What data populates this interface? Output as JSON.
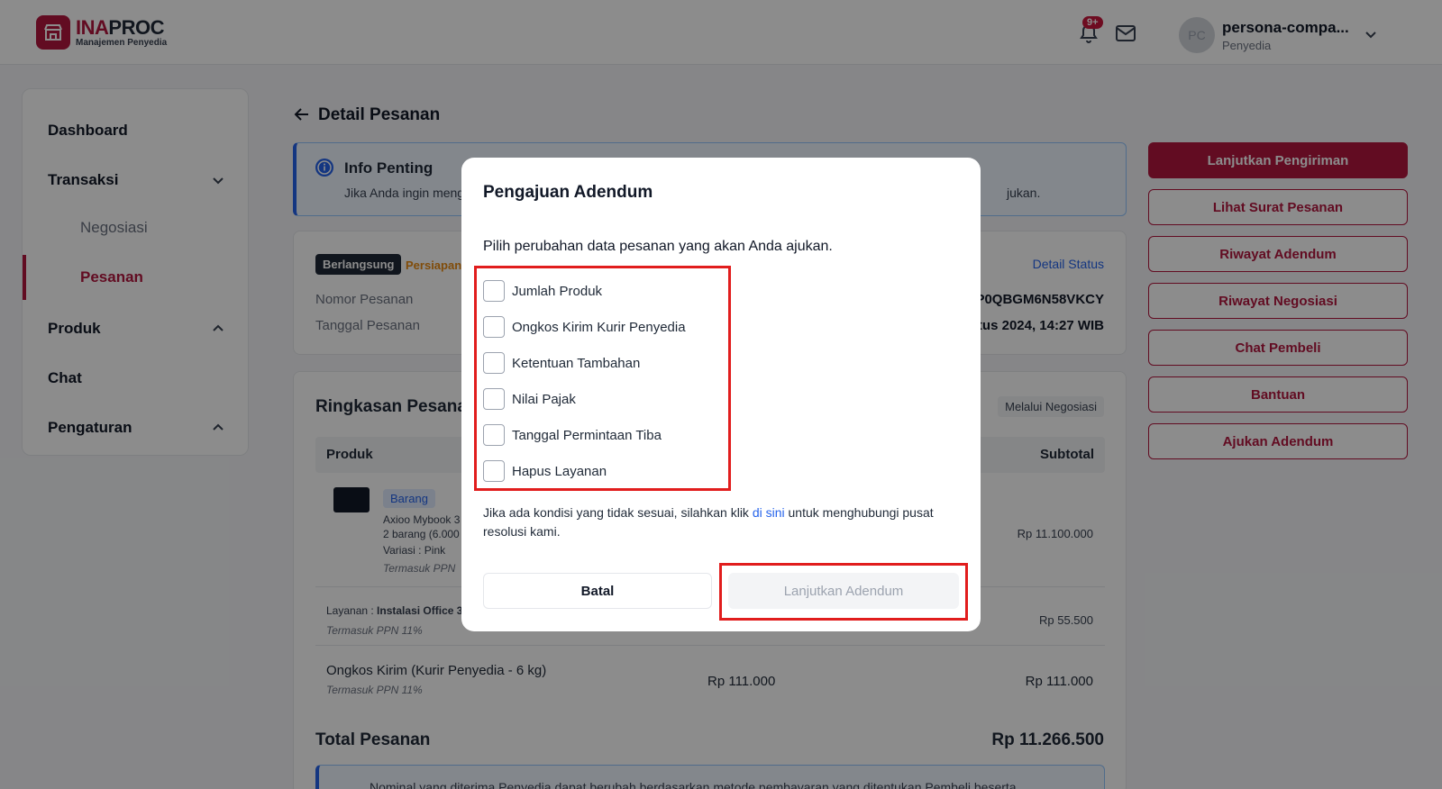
{
  "header": {
    "logo_part1": "INA",
    "logo_part2": "PROC",
    "logo_subtitle": "Manajemen Penyedia",
    "notification_count": "9+",
    "avatar_initials": "PC",
    "user_name": "persona-compa...",
    "user_role": "Penyedia"
  },
  "sidebar": {
    "dashboard": "Dashboard",
    "transaksi": "Transaksi",
    "negosiasi": "Negosiasi",
    "pesanan": "Pesanan",
    "produk": "Produk",
    "chat": "Chat",
    "pengaturan": "Pengaturan"
  },
  "page": {
    "title": "Detail Pesanan",
    "info_title": "Info Penting",
    "info_text_left": "Jika Anda ingin meng",
    "info_text_right": "jukan."
  },
  "status": {
    "badge_state": "Berlangsung",
    "badge_phase": "Persiapan",
    "detail_link": "Detail Status",
    "order_number_label": "Nomor Pesanan",
    "order_number_value": "RP0QBGM6N58VKCY",
    "order_date_label": "Tanggal Pesanan",
    "order_date_value": "stus 2024, 14:27 WIB"
  },
  "summary": {
    "title": "Ringkasan Pesana",
    "via_badge": "Melalui Negosiasi",
    "col_product": "Produk",
    "col_subtotal": "Subtotal",
    "item_tag": "Barang",
    "item_name": "Axioo Mybook 3",
    "item_qty": "2 barang (6.000",
    "item_variant": "Variasi   : Pink",
    "item_tax": "Termasuk PPN",
    "item_price": "Rp 11.100.000",
    "service_prefix": "Layanan : ",
    "service_name": "Instalasi Office 3",
    "service_tax": "Termasuk PPN 11%",
    "service_price": "Rp 55.500",
    "shipping_label": "Ongkos Kirim (Kurir Penyedia - 6 kg)",
    "shipping_tax": "Termasuk PPN 11%",
    "shipping_unit": "Rp 111.000",
    "shipping_subtotal": "Rp 111.000",
    "total_label": "Total Pesanan",
    "total_value": "Rp 11.266.500",
    "note_text": "Nominal yang diterima Penyedia dapat berubah berdasarkan metode pembayaran yang ditentukan Pembeli beserta"
  },
  "actions": [
    "Lanjutkan Pengiriman",
    "Lihat Surat Pesanan",
    "Riwayat Adendum",
    "Riwayat Negosiasi",
    "Chat Pembeli",
    "Bantuan",
    "Ajukan Adendum"
  ],
  "modal": {
    "title": "Pengajuan Adendum",
    "description": "Pilih perubahan data pesanan yang akan Anda ajukan.",
    "options": [
      "Jumlah Produk",
      "Ongkos Kirim Kurir Penyedia",
      "Ketentuan Tambahan",
      "Nilai Pajak",
      "Tanggal Permintaan Tiba",
      "Hapus Layanan"
    ],
    "help_before": "Jika ada kondisi yang tidak sesuai, silahkan klik ",
    "help_link": "di sini",
    "help_after": " untuk menghubungi pusat resolusi kami.",
    "cancel_label": "Batal",
    "continue_label": "Lanjutkan Adendum"
  }
}
